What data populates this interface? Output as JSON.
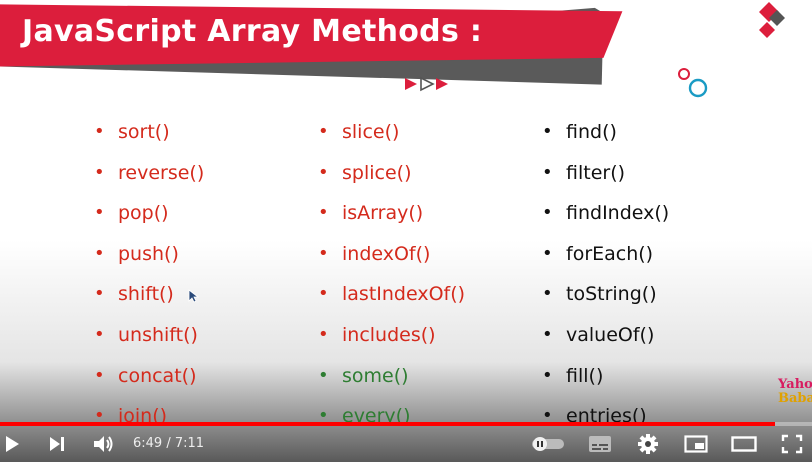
{
  "slide": {
    "title": "JavaScript Array Methods :",
    "columns": [
      [
        {
          "text": "sort()",
          "color": "red"
        },
        {
          "text": "reverse()",
          "color": "red"
        },
        {
          "text": "pop()",
          "color": "red"
        },
        {
          "text": "push()",
          "color": "red"
        },
        {
          "text": "shift()",
          "color": "red"
        },
        {
          "text": "unshift()",
          "color": "red"
        },
        {
          "text": "concat()",
          "color": "red"
        },
        {
          "text": "join()",
          "color": "red"
        }
      ],
      [
        {
          "text": "slice()",
          "color": "red"
        },
        {
          "text": "splice()",
          "color": "red"
        },
        {
          "text": "isArray()",
          "color": "red"
        },
        {
          "text": "indexOf()",
          "color": "red"
        },
        {
          "text": "lastIndexOf()",
          "color": "red"
        },
        {
          "text": "includes()",
          "color": "red"
        },
        {
          "text": "some()",
          "color": "green"
        },
        {
          "text": "every()",
          "color": "green"
        }
      ],
      [
        {
          "text": "find()",
          "color": "black"
        },
        {
          "text": "filter()",
          "color": "black"
        },
        {
          "text": "findIndex()",
          "color": "black"
        },
        {
          "text": "forEach()",
          "color": "black"
        },
        {
          "text": "toString()",
          "color": "black"
        },
        {
          "text": "valueOf()",
          "color": "black"
        },
        {
          "text": "fill()",
          "color": "black"
        },
        {
          "text": "entries()",
          "color": "black"
        }
      ]
    ],
    "bullet": "•",
    "watermark": {
      "line1": "Yahoo",
      "line2": "Baba"
    },
    "colors": {
      "banner": "#dc1e3c",
      "banner_shadow": "#555555",
      "red_text": "#d42a1c",
      "green_text": "#2e7d32",
      "accent_teal": "#1a9bc4"
    }
  },
  "player": {
    "time_display": "6:49 / 7:11",
    "progress_fraction": 0.955,
    "icons": [
      "play-icon",
      "next-icon",
      "volume-icon",
      "autoplay-toggle-icon",
      "subtitles-icon",
      "settings-gear-icon",
      "miniplayer-icon",
      "theater-mode-icon",
      "fullscreen-icon"
    ],
    "progress_color": "#ff0000"
  }
}
